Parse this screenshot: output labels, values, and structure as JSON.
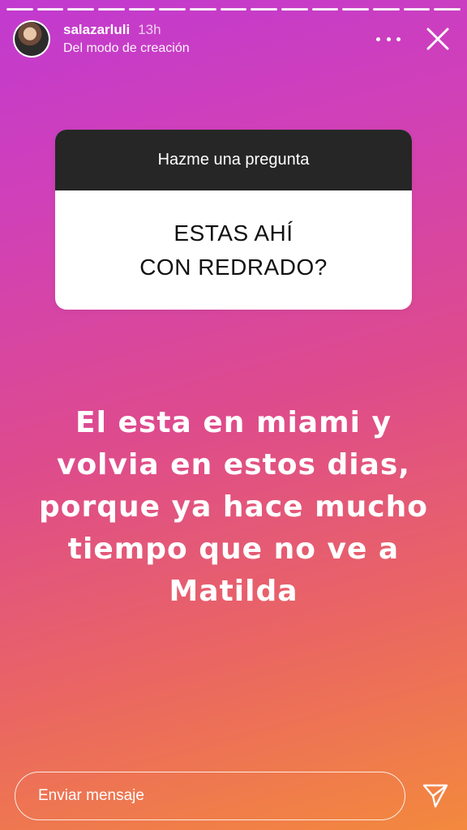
{
  "progress": {
    "segments": 15,
    "viewed": 15
  },
  "header": {
    "username": "salazarluli",
    "time": "13h",
    "subtitle": "Del modo de creación",
    "avatar_icon": "profile-avatar",
    "more_icon": "more-horizontal-icon",
    "close_icon": "close-icon"
  },
  "question_sticker": {
    "title": "Hazme una pregunta",
    "question_lines": [
      "ESTAS AHÍ",
      "CON REDRADO?"
    ]
  },
  "answer_text_lines": [
    "El esta en miami y",
    "volvia en estos dias,",
    "porque ya hace mucho",
    "tiempo que no ve a",
    "Matilda"
  ],
  "footer": {
    "placeholder": "Enviar mensaje",
    "send_icon": "send-icon"
  },
  "colors": {
    "gradient_top": "#c13ad0",
    "gradient_mid": "#de4b8c",
    "gradient_bottom": "#f3893d",
    "sticker_header": "#262626"
  }
}
